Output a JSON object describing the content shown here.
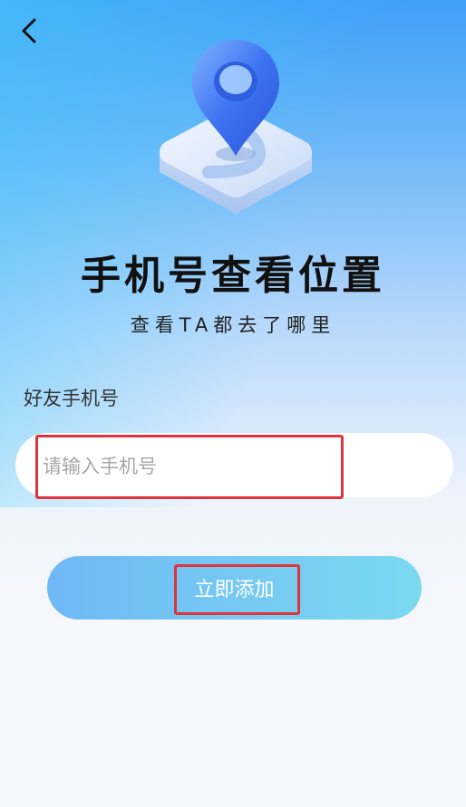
{
  "header": {
    "back_icon": "chevron-left-icon"
  },
  "hero": {
    "icon": "map-location-pin-icon"
  },
  "title": "手机号查看位置",
  "subtitle": "查看TA都去了哪里",
  "form": {
    "label": "好友手机号",
    "phone_value": "",
    "phone_placeholder": "请输入手机号",
    "submit_label": "立即添加"
  },
  "colors": {
    "accent_start": "#6fb8f6",
    "accent_end": "#7bd9ef",
    "highlight": "#e0343c"
  }
}
